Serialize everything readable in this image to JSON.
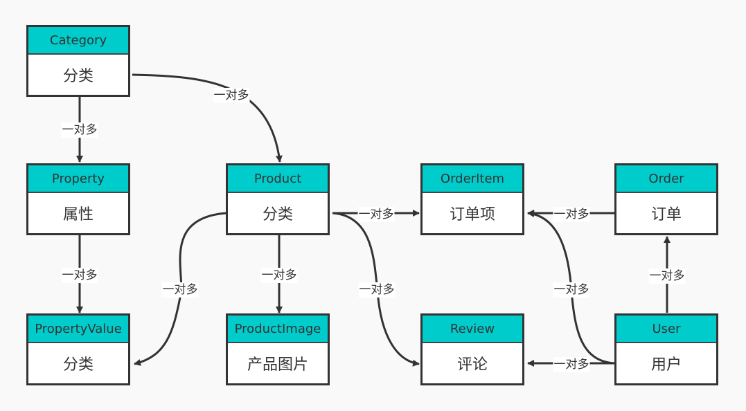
{
  "colors": {
    "header": "#00cccc",
    "stroke": "#333333",
    "background": "#f9f9f9"
  },
  "entities": [
    {
      "id": "category",
      "name": "Category",
      "desc": "分类"
    },
    {
      "id": "property",
      "name": "Property",
      "desc": "属性"
    },
    {
      "id": "propertyvalue",
      "name": "PropertyValue",
      "desc": "分类"
    },
    {
      "id": "product",
      "name": "Product",
      "desc": "分类"
    },
    {
      "id": "productimage",
      "name": "ProductImage",
      "desc": "产品图片"
    },
    {
      "id": "orderitem",
      "name": "OrderItem",
      "desc": "订单项"
    },
    {
      "id": "review",
      "name": "Review",
      "desc": "评论"
    },
    {
      "id": "order",
      "name": "Order",
      "desc": "订单"
    },
    {
      "id": "user",
      "name": "User",
      "desc": "用户"
    }
  ],
  "relations": [
    {
      "from": "Category",
      "to": "Property",
      "label": "一对多"
    },
    {
      "from": "Category",
      "to": "Product",
      "label": "一对多"
    },
    {
      "from": "Property",
      "to": "PropertyValue",
      "label": "一对多"
    },
    {
      "from": "Product",
      "to": "PropertyValue",
      "label": "一对多"
    },
    {
      "from": "Product",
      "to": "ProductImage",
      "label": "一对多"
    },
    {
      "from": "Product",
      "to": "OrderItem",
      "label": "一对多"
    },
    {
      "from": "Product",
      "to": "Review",
      "label": "一对多"
    },
    {
      "from": "Order",
      "to": "OrderItem",
      "label": "一对多"
    },
    {
      "from": "User",
      "to": "OrderItem",
      "label": "一对多"
    },
    {
      "from": "User",
      "to": "Order",
      "label": "一对多"
    },
    {
      "from": "User",
      "to": "Review",
      "label": "一对多"
    }
  ]
}
